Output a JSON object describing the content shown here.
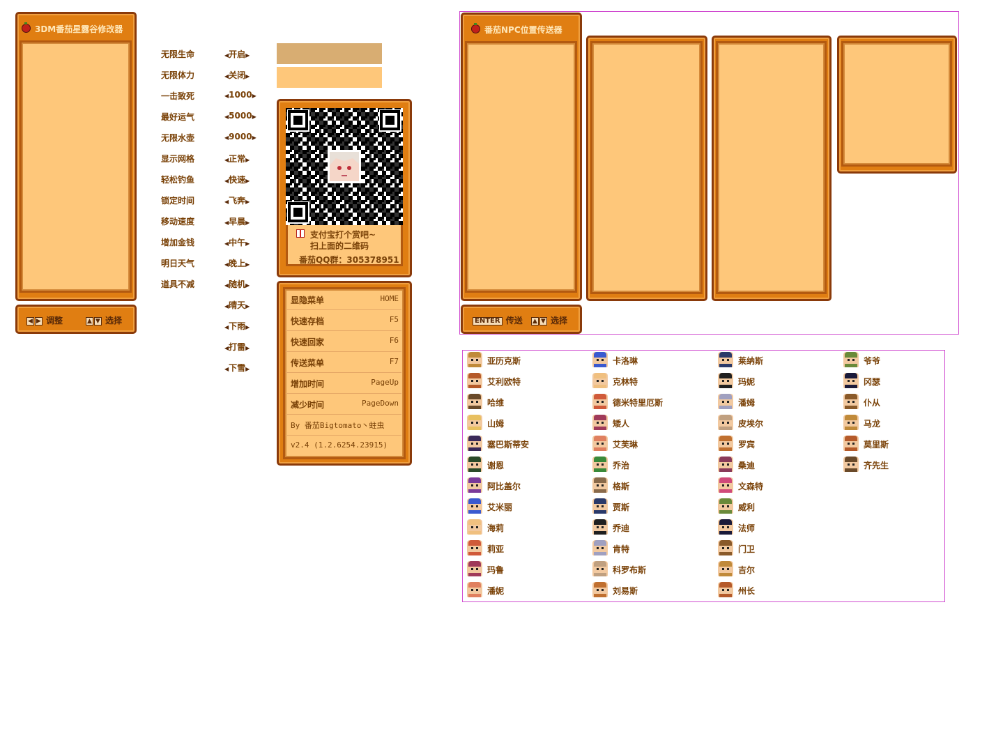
{
  "cheat_window": {
    "title": "3DM番茄星露谷修改器",
    "footer": {
      "adjust_label": "调整",
      "select_label": "选择"
    }
  },
  "cheats": [
    {
      "label": "无限生命",
      "value": "开启"
    },
    {
      "label": "无限体力",
      "value": "关闭"
    },
    {
      "label": "一击致死",
      "value": "1000"
    },
    {
      "label": "最好运气",
      "value": "5000"
    },
    {
      "label": "无限水壶",
      "value": "9000"
    },
    {
      "label": "显示网格",
      "value": "正常"
    },
    {
      "label": "轻松钓鱼",
      "value": "快速"
    },
    {
      "label": "锁定时间",
      "value": "飞奔"
    },
    {
      "label": "移动速度",
      "value": "早晨"
    },
    {
      "label": "增加金钱",
      "value": "中午"
    },
    {
      "label": "明日天气",
      "value": "晚上"
    },
    {
      "label": "道具不减",
      "value": "随机"
    }
  ],
  "extra_values": [
    "晴天",
    "下雨",
    "打雷",
    "下雪"
  ],
  "swatches": {
    "dark": "#d8ad72",
    "light": "#fec77a"
  },
  "donate": {
    "line1": "支付宝打个赏吧~",
    "line2": "扫上面的二维码",
    "qq": "番茄QQ群：305378951"
  },
  "hotkeys": [
    {
      "label": "显隐菜单",
      "key": "HOME"
    },
    {
      "label": "快速存档",
      "key": "F5"
    },
    {
      "label": "快速回家",
      "key": "F6"
    },
    {
      "label": "传送菜单",
      "key": "F7"
    },
    {
      "label": "增加时间",
      "key": "PageUp"
    },
    {
      "label": "减少时间",
      "key": "PageDown"
    }
  ],
  "credits": {
    "author": "By 番茄Bigtomato丶蛀虫",
    "version": "v2.4 (1.2.6254.23915)"
  },
  "teleport_window": {
    "title": "番茄NPC位置传送器",
    "footer": {
      "enter_key": "ENTER",
      "teleport_label": "传送",
      "select_label": "选择"
    }
  },
  "npc_columns": [
    [
      "亚历克斯",
      "艾利欧特",
      "哈维",
      "山姆",
      "塞巴斯蒂安",
      "谢恩",
      "阿比盖尔",
      "艾米丽",
      "海莉",
      "莉亚",
      "玛鲁",
      "潘妮"
    ],
    [
      "卡洛琳",
      "克林特",
      "德米特里厄斯",
      "矮人",
      "艾芙琳",
      "乔治",
      "格斯",
      "贾斯",
      "乔迪",
      "肯特",
      "科罗布斯",
      "刘易斯"
    ],
    [
      "莱纳斯",
      "玛妮",
      "潘姆",
      "皮埃尔",
      "罗宾",
      "桑迪",
      "文森特",
      "威利",
      "法师",
      "门卫",
      "吉尔",
      "州长"
    ],
    [
      "爷爷",
      "冈瑟",
      "仆从",
      "马龙",
      "莫里斯",
      "齐先生"
    ]
  ],
  "colors": {
    "panel_border": "#8a3a0a",
    "panel_fill": "#e07e12",
    "panel_inner": "#fec77a",
    "text": "#7a4208",
    "guide": "#d04ad0"
  }
}
